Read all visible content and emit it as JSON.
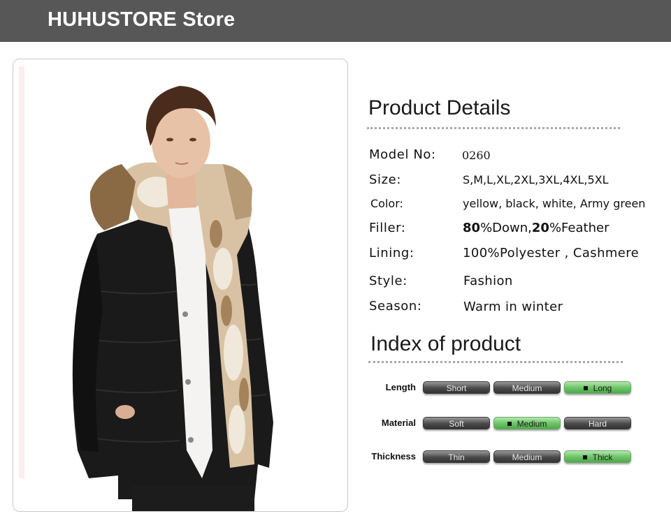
{
  "store": {
    "title": "HUHUSTORE Store"
  },
  "details": {
    "heading": "Product Details",
    "rows": [
      {
        "label": "Model No:",
        "value": "0260"
      },
      {
        "label": "Size:",
        "value": "S,M,L,XL,2XL,3XL,4XL,5XL"
      },
      {
        "label": "Color:",
        "value": "yellow, black, white, Army green"
      },
      {
        "label": "Filler:",
        "value_parts": [
          "80",
          "%Down,",
          "20",
          "%Feather"
        ]
      },
      {
        "label": "Lining:",
        "value": "100%Polyester , Cashmere"
      },
      {
        "label": "Style:",
        "value": "Fashion"
      },
      {
        "label": "Season:",
        "value": "Warm in winter"
      }
    ]
  },
  "index": {
    "heading": "Index of product",
    "rows": [
      {
        "label": "Length",
        "options": [
          "Short",
          "Medium",
          "Long"
        ],
        "selected": "Long"
      },
      {
        "label": "Material",
        "options": [
          "Soft",
          "Medium",
          "Hard"
        ],
        "selected": "Medium"
      },
      {
        "label": "Thickness",
        "options": [
          "Thin",
          "Medium",
          "Thick"
        ],
        "selected": "Thick"
      }
    ]
  },
  "colors": {
    "header_bg": "#575757",
    "selected_green": "#6fc669",
    "unselected_dark": "#4a4a4a"
  }
}
